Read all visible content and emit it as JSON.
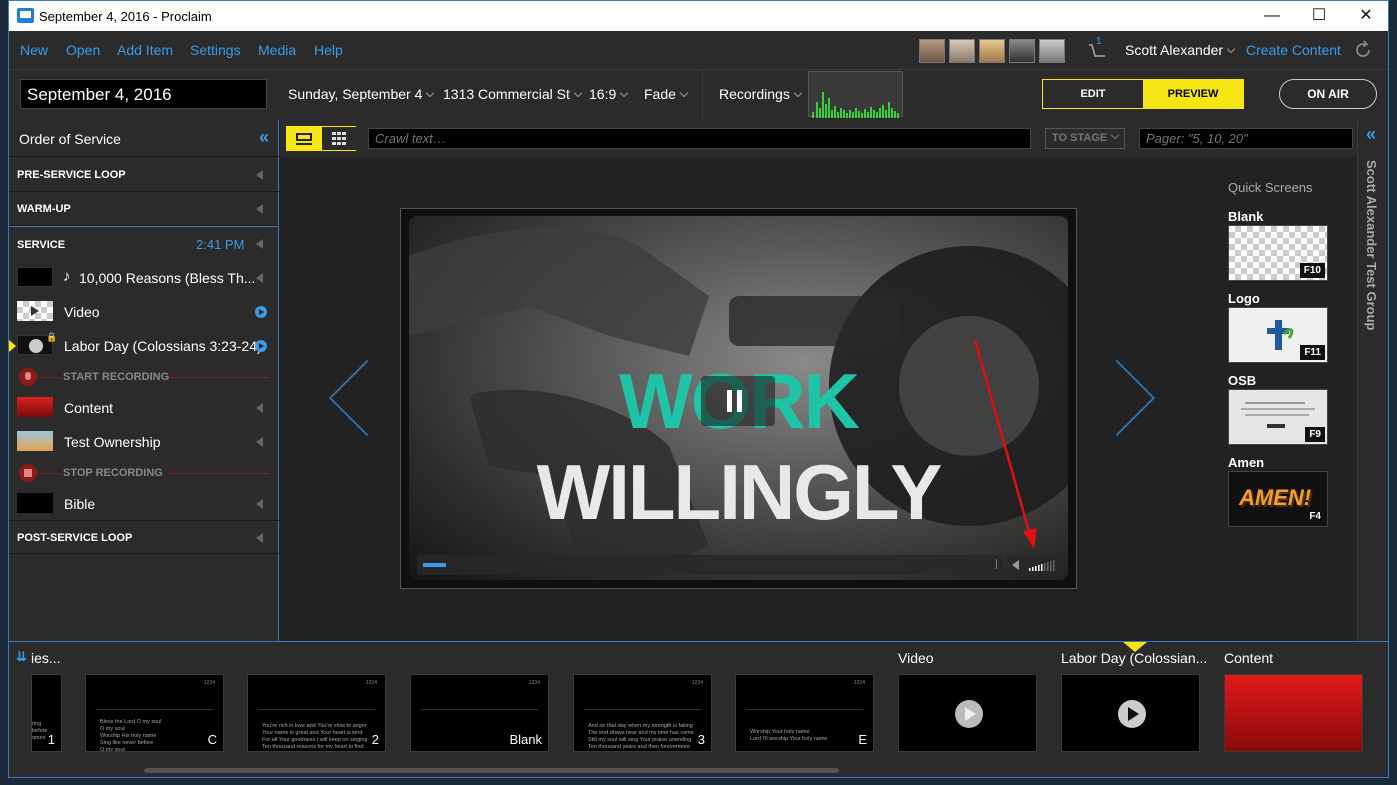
{
  "window": {
    "title": "September 4, 2016 - Proclaim"
  },
  "menu": {
    "items": [
      "New",
      "Open",
      "Add Item",
      "Settings",
      "Media",
      "Help"
    ],
    "cart_count": "1",
    "user_name": "Scott Alexander",
    "create_content": "Create Content"
  },
  "toolbar": {
    "presentation_title": "September 4, 2016",
    "date": "Sunday, September 4",
    "location": "1313 Commercial St",
    "aspect": "16:9",
    "transition": "Fade",
    "recordings": "Recordings",
    "edit_label": "EDIT",
    "preview_label": "PREVIEW",
    "onair_label": "ON AIR"
  },
  "order_panel": {
    "title": "Order of Service",
    "pre_service": "PRE-SERVICE LOOP",
    "warm_up": "WARM-UP",
    "service": "SERVICE",
    "service_time": "2:41 PM",
    "items": [
      {
        "label": "10,000 Reasons (Bless Th...",
        "icon": "music-note-icon"
      },
      {
        "label": "Video"
      },
      {
        "label": "Labor Day (Colossians 3:23-24)"
      },
      {
        "label": "Content"
      },
      {
        "label": "Test Ownership"
      },
      {
        "label": "Bible"
      }
    ],
    "start_recording": "START RECORDING",
    "stop_recording": "STOP RECORDING",
    "post_service": "POST-SERVICE LOOP"
  },
  "stage": {
    "crawl_placeholder": "Crawl text…",
    "to_stage": "TO STAGE",
    "pager_placeholder": "Pager: \"5, 10, 20\"",
    "video_title_part1": "WORK",
    "video_title_part2": "WILLINGLY",
    "progress_fraction": 0.04,
    "volume_level": 0.5
  },
  "quick_screens": {
    "title": "Quick Screens",
    "items": [
      {
        "label": "Blank",
        "key": "F10"
      },
      {
        "label": "Logo",
        "key": "F11"
      },
      {
        "label": "OSB",
        "key": "F9"
      },
      {
        "label": "Amen",
        "key": "F4",
        "overlay_text": "AMEN!"
      }
    ],
    "group_name": "Scott Alexander Test Group"
  },
  "slides": {
    "partial_label": "ies...",
    "thumbs": [
      {
        "badge": "1",
        "lyric": "ring\nbefore\nomes"
      },
      {
        "badge": "C",
        "lyric": "Bless the Lord O my soul\nO my soul\nWorship His holy name\nSing like never before\nO my soul\nI'll worship Your holy name"
      },
      {
        "badge": "2",
        "lyric": "You're rich in love and You're slow to anger\nYour name is great and Your heart is kind\nFor all Your goodness I will keep on singing\nTen thousand reasons for my heart to find"
      },
      {
        "badge": "Blank",
        "lyric": ""
      },
      {
        "badge": "3",
        "lyric": "And on that day when my strength is failing\nThe end draws near and my time has come\nStill my soul will sing Your praise unending\nTen thousand years and then forevermore"
      },
      {
        "badge": "E",
        "lyric": "Worship Your holy name\nLord I'll worship Your holy name"
      }
    ],
    "mini_num": "1234",
    "video_label": "Video",
    "labor_day_label": "Labor Day (Colossian...",
    "content_label": "Content"
  },
  "colors": {
    "accent_blue": "#3a9be8",
    "preview_yellow": "#f5e614",
    "teal_title": "#1fc3a5",
    "record_red": "#8b1a1a"
  }
}
